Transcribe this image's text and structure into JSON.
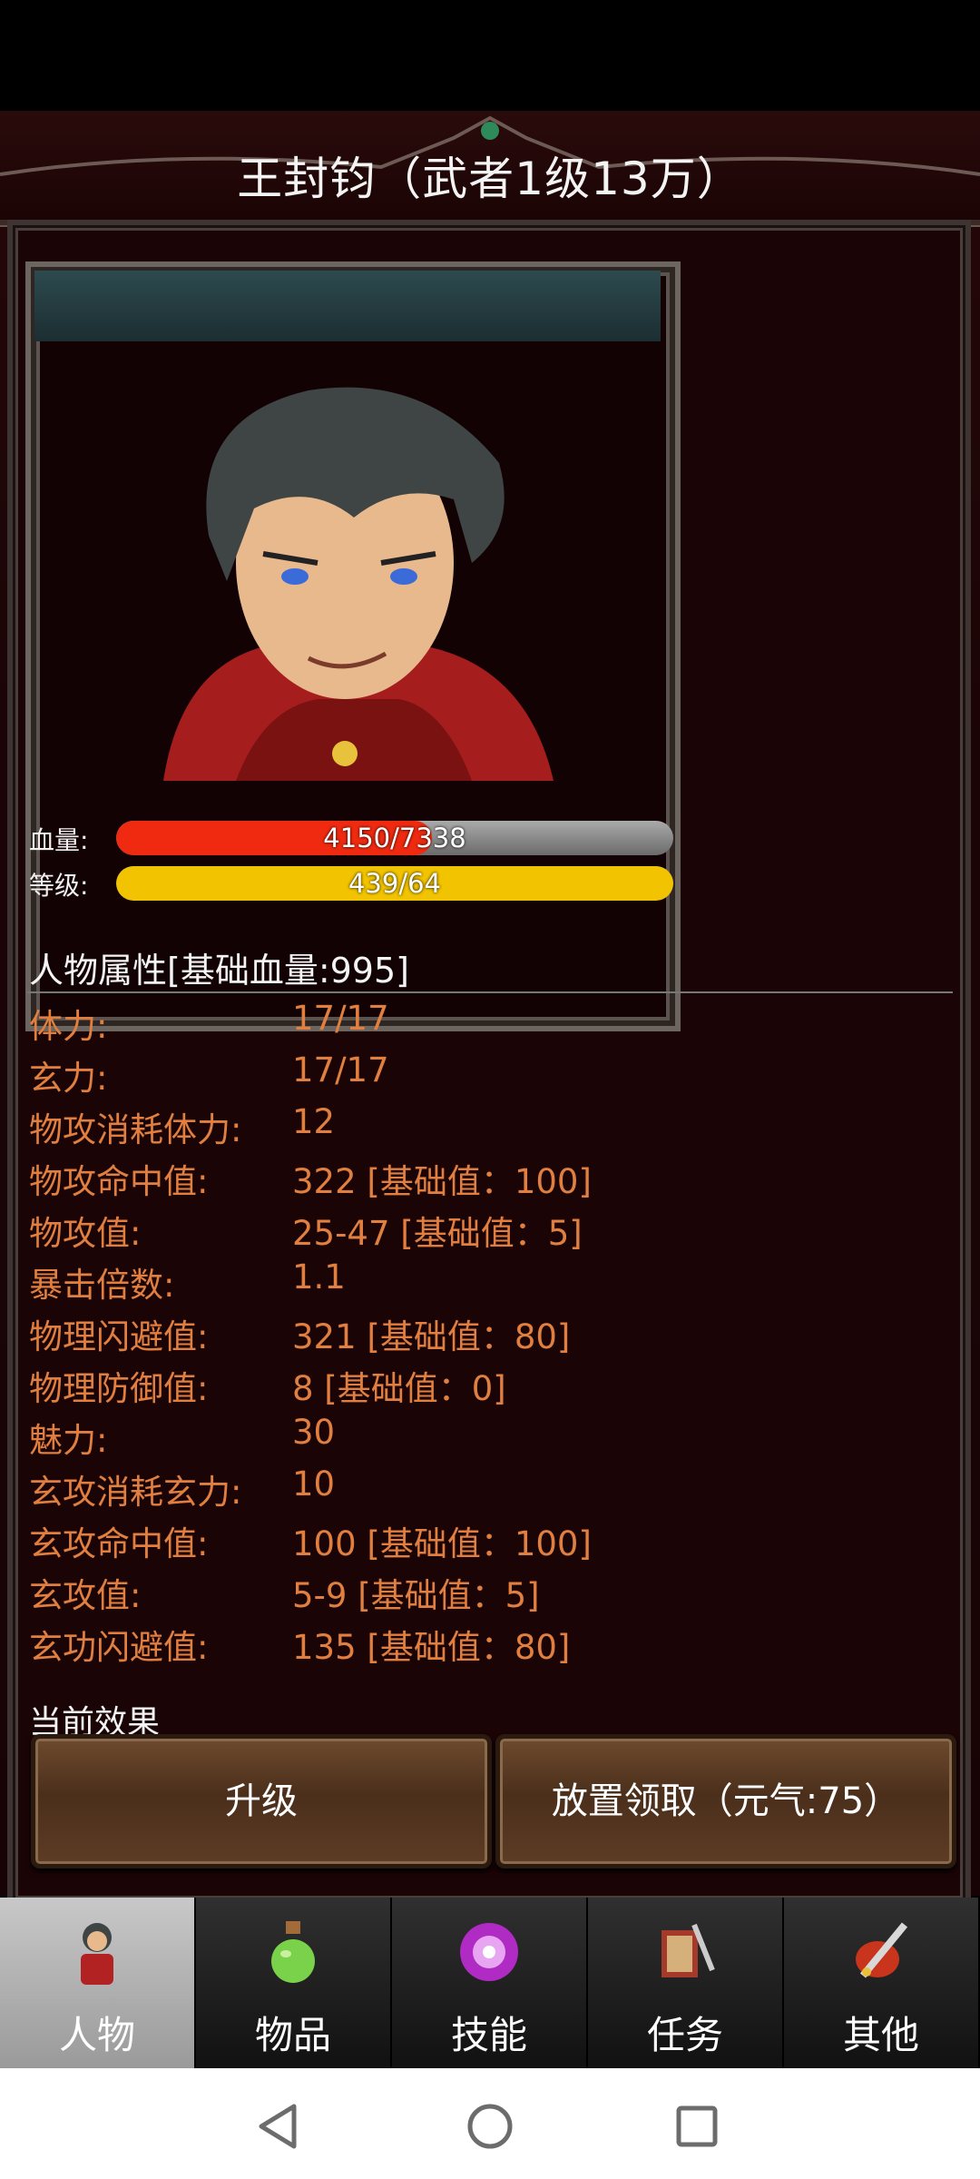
{
  "title": "王封钧（武者1级13万）",
  "bars": {
    "hp_label": "血量:",
    "hp_text": "4150/7338",
    "hp_fraction": 0.566,
    "hp_color": "#ef2a10",
    "level_label": "等级:",
    "level_text": "439/64",
    "level_fraction": 1.0,
    "level_color": "#f2c300"
  },
  "section_title": "人物属性[基础血量:995]",
  "attributes": [
    {
      "key": "体力:",
      "value": "17/17"
    },
    {
      "key": "玄力:",
      "value": "17/17"
    },
    {
      "key": "物攻消耗体力:",
      "value": "12"
    },
    {
      "key": "物攻命中值:",
      "value": "322 [基础值：100]"
    },
    {
      "key": "物攻值:",
      "value": "25-47 [基础值：5]"
    },
    {
      "key": "暴击倍数:",
      "value": "1.1"
    },
    {
      "key": "物理闪避值:",
      "value": "321 [基础值：80]"
    },
    {
      "key": "物理防御值:",
      "value": "8 [基础值：0]"
    },
    {
      "key": "魅力:",
      "value": "30"
    },
    {
      "key": "玄攻消耗玄力:",
      "value": "10"
    },
    {
      "key": "玄攻命中值:",
      "value": "100 [基础值：100]"
    },
    {
      "key": "玄攻值:",
      "value": "5-9 [基础值：5]"
    },
    {
      "key": "玄功闪避值:",
      "value": "135 [基础值：80]"
    }
  ],
  "effects_title": "当前效果",
  "buttons": {
    "upgrade": "升级",
    "claim": "放置领取（元气:75）"
  },
  "tabs": [
    {
      "label": "人物",
      "icon": "character-icon",
      "active": true
    },
    {
      "label": "物品",
      "icon": "potion-icon",
      "active": false
    },
    {
      "label": "技能",
      "icon": "skill-orb-icon",
      "active": false
    },
    {
      "label": "任务",
      "icon": "quest-book-icon",
      "active": false
    },
    {
      "label": "其他",
      "icon": "sword-shield-icon",
      "active": false
    }
  ],
  "colors": {
    "attr_text": "#e07f3f",
    "background": "#1b0406"
  }
}
